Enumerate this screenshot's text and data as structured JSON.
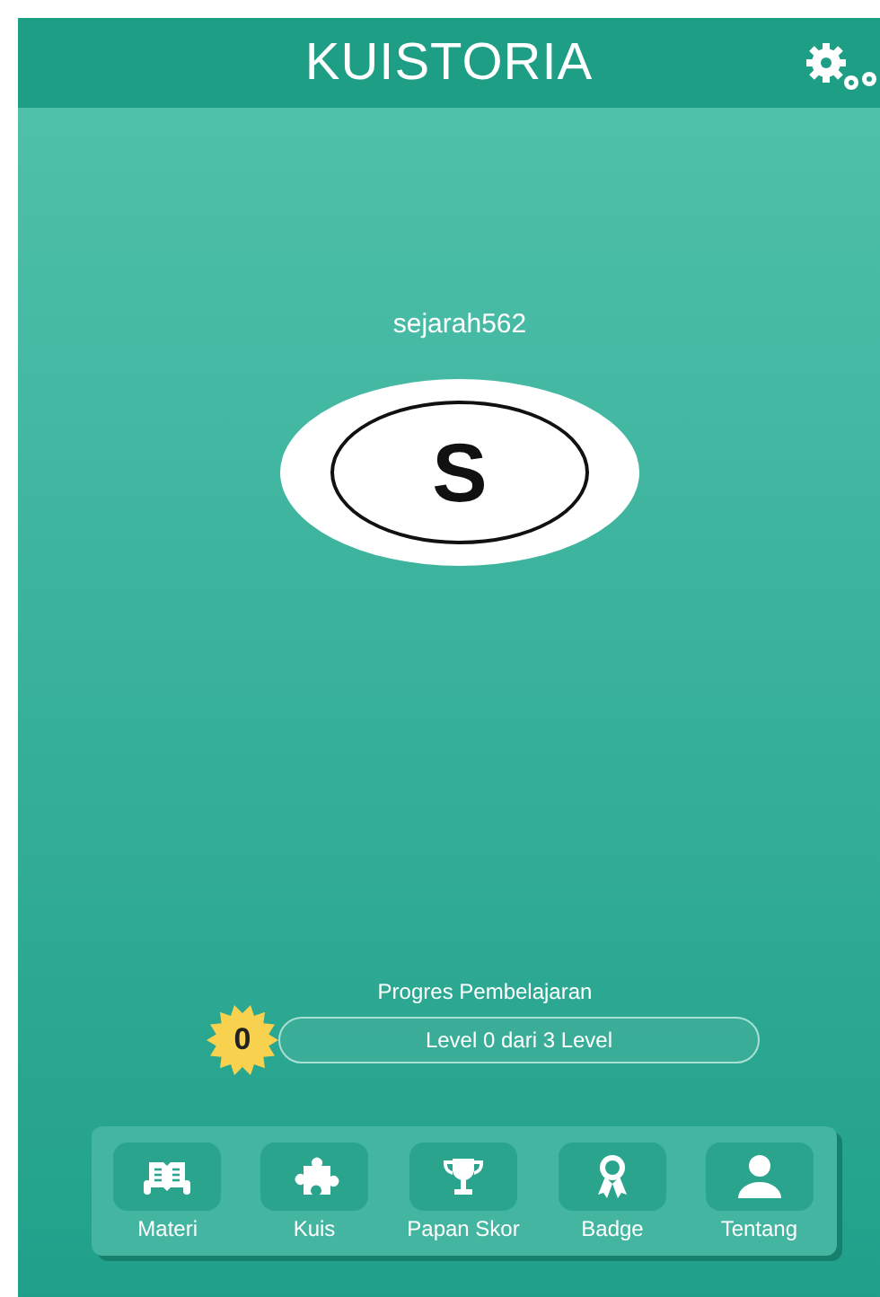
{
  "header": {
    "title": "KUISTORIA"
  },
  "profile": {
    "username": "sejarah562",
    "initial": "S"
  },
  "progress": {
    "label": "Progres Pembelajaran",
    "badge": "0",
    "level": 0,
    "text": "Level 0 dari 3 Level"
  },
  "nav": [
    {
      "kind": "book",
      "label": "Materi"
    },
    {
      "kind": "puzzle",
      "label": "Kuis"
    },
    {
      "kind": "trophy",
      "label": "Papan Skor"
    },
    {
      "kind": "ribbon",
      "label": "Badge"
    },
    {
      "kind": "person",
      "label": "Tentang"
    }
  ]
}
